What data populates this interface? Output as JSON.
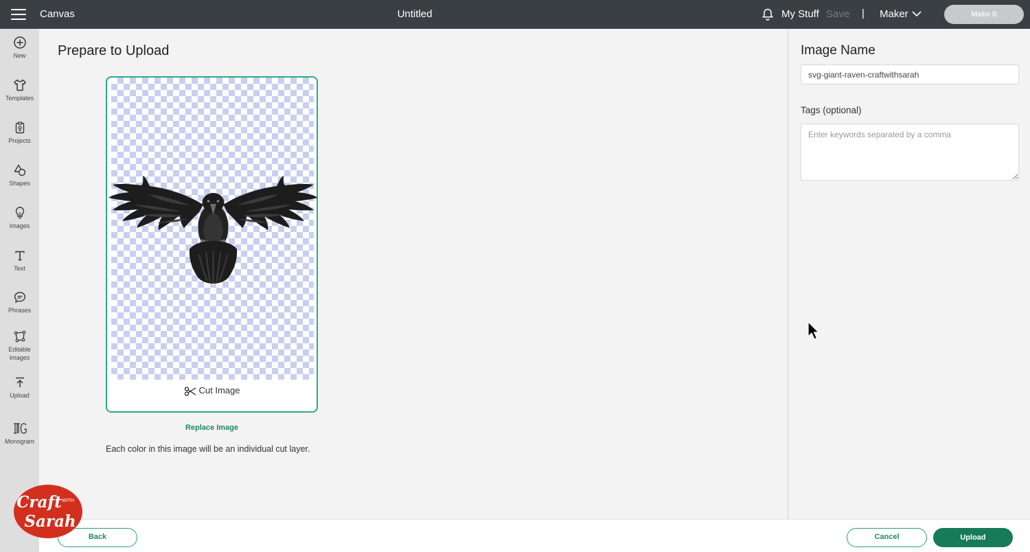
{
  "topbar": {
    "app_title": "Canvas",
    "document_title": "Untitled",
    "my_stuff": "My Stuff",
    "save": "Save",
    "separator": "|",
    "machine": "Maker",
    "make_it": "Make It"
  },
  "sidebar": {
    "items": [
      {
        "label": "New",
        "icon": "plus-circle-icon"
      },
      {
        "label": "Templates",
        "icon": "tshirt-icon"
      },
      {
        "label": "Projects",
        "icon": "clipboard-icon"
      },
      {
        "label": "Shapes",
        "icon": "shapes-icon"
      },
      {
        "label": "Images",
        "icon": "lightbulb-icon"
      },
      {
        "label": "Text",
        "icon": "text-icon"
      },
      {
        "label": "Phrases",
        "icon": "speech-bubble-icon"
      },
      {
        "label": "Editable Images",
        "icon": "editable-image-icon"
      },
      {
        "label": "Upload",
        "icon": "upload-icon"
      },
      {
        "label": "Monogram",
        "icon": "monogram-icon"
      }
    ]
  },
  "main": {
    "title": "Prepare to Upload",
    "cut_image_label": "Cut Image",
    "replace_image": "Replace Image",
    "note": "Each color in this image will be an individual cut layer."
  },
  "panel": {
    "image_name_label": "Image Name",
    "image_name_value": "svg-giant-raven-craftwithsarah",
    "tags_label": "Tags (optional)",
    "tags_placeholder": "Enter keywords separated by a comma"
  },
  "footer": {
    "back": "Back",
    "cancel": "Cancel",
    "upload": "Upload"
  },
  "watermark": {
    "line1": "Craft",
    "line2": "WITH",
    "line3": "Sarah"
  },
  "colors": {
    "topbar": "#3a3f44",
    "accent": "#2eaa80",
    "primary_button": "#177a58",
    "logo": "#d32f1e"
  }
}
